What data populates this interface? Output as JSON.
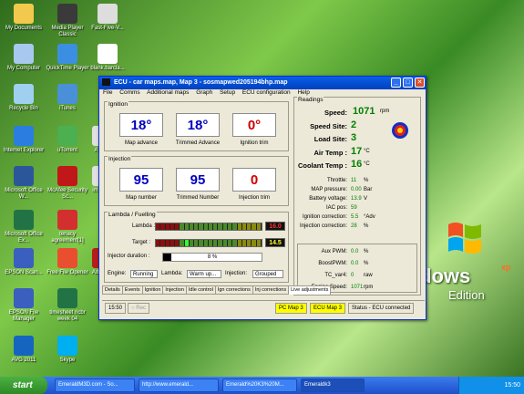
{
  "desktop": {
    "icons": [
      {
        "label": "My Documents",
        "name": "my-documents-icon",
        "color": "#f2c94c"
      },
      {
        "label": "Media Player Classic",
        "name": "media-player-icon",
        "color": "#3a3a3a"
      },
      {
        "label": "Fast-Five-V...",
        "name": "file-icon",
        "color": "#dddddd"
      },
      {
        "label": "My Computer",
        "name": "my-computer-icon",
        "color": "#a8c8f0"
      },
      {
        "label": "QuickTime Player",
        "name": "quicktime-icon",
        "color": "#3c8fe0"
      },
      {
        "label": "blank.barcla...",
        "name": "document-icon",
        "color": "#ffffff"
      },
      {
        "label": "Recycle Bin",
        "name": "recycle-bin-icon",
        "color": "#9fd0f0"
      },
      {
        "label": "iTunes",
        "name": "itunes-icon",
        "color": "#4a90d9"
      },
      {
        "label": "Internet Explorer",
        "name": "internet-explorer-icon",
        "color": "#2b7de0"
      },
      {
        "label": "uTorrent",
        "name": "utorrent-icon",
        "color": "#4caf50"
      },
      {
        "label": "Attach",
        "name": "attach-icon",
        "color": "#e0e0e0"
      },
      {
        "label": "Microsoft Office W...",
        "name": "word-icon",
        "color": "#2b579a"
      },
      {
        "label": "McAfee Security Sc...",
        "name": "mcafee-icon",
        "color": "#c01818"
      },
      {
        "label": "image...",
        "name": "image-icon",
        "color": "#e0e0e0"
      },
      {
        "label": "Microsoft Office Ex...",
        "name": "excel-icon",
        "color": "#217346"
      },
      {
        "label": "tenacy agreement[1]",
        "name": "pdf-document-icon",
        "color": "#d32f2f"
      },
      {
        "label": "EPSON Scan...",
        "name": "epson-icon",
        "color": "#3a5fbf"
      },
      {
        "label": "Free File Opener",
        "name": "file-opener-icon",
        "color": "#e94f2e"
      },
      {
        "label": "Adobe...",
        "name": "adobe-icon",
        "color": "#b71c1c"
      },
      {
        "label": "EPSON File Manager",
        "name": "epson-file-icon",
        "color": "#3a5fbf"
      },
      {
        "label": "timesheet ricbr week 04",
        "name": "timesheet-icon",
        "color": "#217346"
      },
      {
        "label": "AVG 2011",
        "name": "avg-icon",
        "color": "#1565c0"
      },
      {
        "label": "Skype",
        "name": "skype-icon",
        "color": "#00aff0"
      }
    ],
    "xp_word": "dows",
    "xp_super": "xp",
    "xp_edition": "Edition"
  },
  "window": {
    "title": "ECU - car maps.map,  Map 3 - sosmapwed205194bhp.map",
    "menu": [
      "File",
      "Comms",
      "Additional maps",
      "Graph",
      "Setup",
      "ECU configuration",
      "Help"
    ],
    "ignition": {
      "label": "Ignition",
      "advance": "18°",
      "advance_cap": "Map advance",
      "trimmed": "18°",
      "trimmed_cap": "Trimmed Advance",
      "trim": "0°",
      "trim_cap": "Ignition trim"
    },
    "injection": {
      "label": "Injection",
      "map_number": "95",
      "map_number_cap": "Map number",
      "trimmed_number": "95",
      "trimmed_number_cap": "Trimmed Number",
      "trim": "0",
      "trim_cap": "Injection trim"
    },
    "lambda": {
      "label": "Lambda / Fuelling",
      "lambda_lbl": "Lambda :",
      "lambda_val": "16.0",
      "target_lbl": "Target :",
      "target_val": "14.5",
      "duration_lbl": "Injector duration :",
      "duration_val": "8 %",
      "duration_level": 0.08,
      "engine_lbl": "Engine:",
      "engine_val": "Running",
      "lambda_state_lbl": "Lambda:",
      "lambda_state_val": "Warm up...",
      "injection_lbl": "Injection:",
      "injection_val": "Grouped"
    },
    "readings": {
      "label": "Readings",
      "speed_lbl": "Speed:",
      "speed_val": "1071",
      "speed_unit": "rpm",
      "speed_site_lbl": "Speed Site:",
      "speed_site_val": "2",
      "load_site_lbl": "Load Site:",
      "load_site_val": "3",
      "air_lbl": "Air Temp :",
      "air_val": "17",
      "air_unit": "°C",
      "coolant_lbl": "Coolant Temp :",
      "coolant_val": "16",
      "coolant_unit": "°C",
      "small": [
        {
          "lbl": "Throttle:",
          "val": "11",
          "unit": "%"
        },
        {
          "lbl": "MAP pressure:",
          "val": "0.00",
          "unit": "Bar"
        },
        {
          "lbl": "Battery voltage:",
          "val": "13.9",
          "unit": "V"
        },
        {
          "lbl": "IAC pos:",
          "val": "59",
          "unit": ""
        },
        {
          "lbl": "Ignition correction:",
          "val": "5.5",
          "unit": "°Adv"
        },
        {
          "lbl": "Injection correction:",
          "val": "28",
          "unit": "%"
        }
      ],
      "aux": [
        {
          "lbl": "Aux PWM:",
          "val": "0.0",
          "unit": "%"
        },
        {
          "lbl": "BoostPWM:",
          "val": "0.0",
          "unit": "%"
        },
        {
          "lbl": "TC_var4:",
          "val": "0",
          "unit": "raw"
        },
        {
          "lbl": "Engine Speed:",
          "val": "1071",
          "unit": "rpm"
        }
      ]
    },
    "tabs": [
      "Details",
      "Events",
      "Ignition",
      "Injection",
      "Idle control",
      "Ign corrections",
      "Inj corrections",
      "Live adjustments"
    ],
    "status": {
      "time": "15:50",
      "rec": "Rec",
      "pc_map": "PC Map 3",
      "ecu_map": "ECU Map 3",
      "status_text": "Status - ECU connected"
    }
  },
  "taskbar": {
    "start": "start",
    "tasks": [
      "EmeraldM3D.com - So...",
      "http://www.emerald...",
      "Emerald%20K3%20M...",
      "Emeraldk3"
    ],
    "clock": "15:50"
  }
}
